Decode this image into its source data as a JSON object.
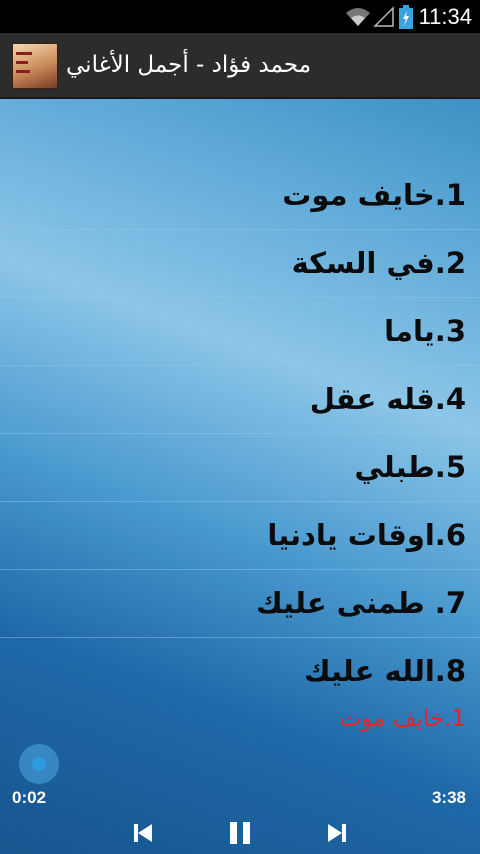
{
  "status_bar": {
    "time": "11:34"
  },
  "app": {
    "title": "محمد فؤاد - أجمل الأغاني"
  },
  "tracks": [
    {
      "label": "1.خايف موت"
    },
    {
      "label": "2.في السكة"
    },
    {
      "label": "3.ياما"
    },
    {
      "label": "4.قله عقل"
    },
    {
      "label": "5.طبلي"
    },
    {
      "label": "6.اوقات يادنيا"
    },
    {
      "label": "7. طمنى عليك"
    },
    {
      "label": "8.الله عليك"
    }
  ],
  "player": {
    "now_playing": "1.خايف موت",
    "elapsed": "0:02",
    "duration": "3:38",
    "progress": 0.01
  },
  "colors": {
    "now_playing": "#e8222b",
    "accent": "#2d9be0",
    "action_bar": "#2c2c2c"
  }
}
